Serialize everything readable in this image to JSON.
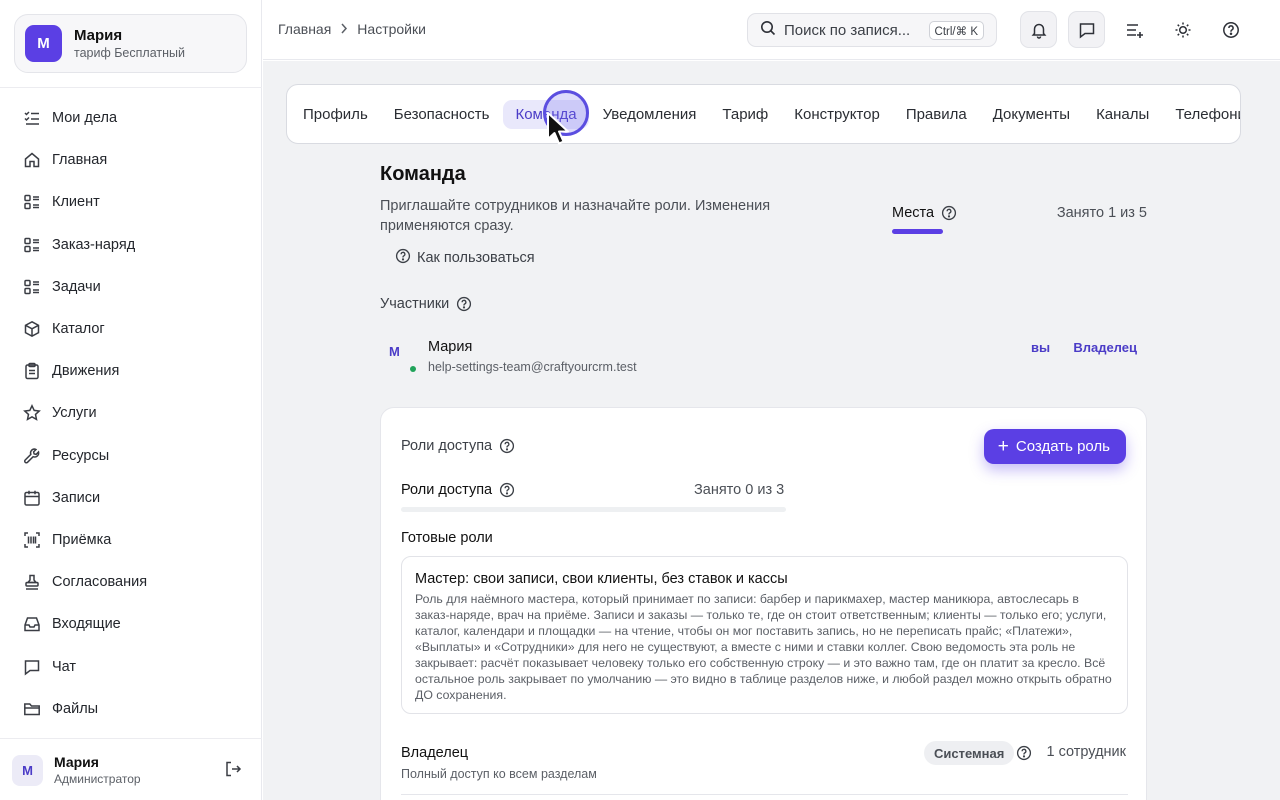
{
  "sidebar": {
    "account": {
      "initial": "М",
      "name": "Мария",
      "plan": "тариф Бесплатный"
    },
    "items": [
      {
        "label": "Мои дела",
        "icon": "checklist-icon"
      },
      {
        "label": "Главная",
        "icon": "home-icon"
      },
      {
        "label": "Клиент",
        "icon": "list-icon"
      },
      {
        "label": "Заказ-наряд",
        "icon": "list-icon"
      },
      {
        "label": "Задачи",
        "icon": "list-icon"
      },
      {
        "label": "Каталог",
        "icon": "box-icon"
      },
      {
        "label": "Движения",
        "icon": "clipboard-icon"
      },
      {
        "label": "Услуги",
        "icon": "star-icon"
      },
      {
        "label": "Ресурсы",
        "icon": "wrench-icon"
      },
      {
        "label": "Записи",
        "icon": "calendar-icon"
      },
      {
        "label": "Приёмка",
        "icon": "scan-icon"
      },
      {
        "label": "Согласования",
        "icon": "stamp-icon"
      },
      {
        "label": "Входящие",
        "icon": "inbox-icon"
      },
      {
        "label": "Чат",
        "icon": "chat-icon"
      },
      {
        "label": "Файлы",
        "icon": "folder-icon"
      }
    ],
    "user": {
      "initial": "М",
      "name": "Мария",
      "role": "Администратор"
    }
  },
  "topbar": {
    "breadcrumb": [
      "Главная",
      "Настройки"
    ],
    "search_placeholder": "Поиск по запися...",
    "shortcut": "Ctrl/⌘ K"
  },
  "tabs": [
    "Профиль",
    "Безопасность",
    "Команда",
    "Уведомления",
    "Тариф",
    "Конструктор",
    "Правила",
    "Документы",
    "Каналы",
    "Телефония"
  ],
  "active_tab": "Команда",
  "team": {
    "title": "Команда",
    "description": "Приглашайте сотрудников и назначайте роли. Изменения применяются сразу.",
    "help_link": "Как пользоваться",
    "seats_label": "Места",
    "seats_count": "Занято 1 из 5",
    "members_title": "Участники",
    "member": {
      "initial": "М",
      "name": "Мария",
      "email": "help-settings-team@craftyourcrm.test",
      "you_label": "вы",
      "role": "Владелец"
    }
  },
  "roles": {
    "title": "Роли доступа",
    "create_button": "Создать роль",
    "sub_title": "Роли доступа",
    "usage": "Занято 0 из 3",
    "usage_fraction": 0,
    "ready_title": "Готовые роли",
    "preset": {
      "title": "Мастер: свои записи, свои клиенты, без ставок и кассы",
      "description": "Роль для наёмного мастера, который принимает по записи: барбер и парикмахер, мастер маникюра, автослесарь в заказ-наряде, врач на приёме. Записи и заказы — только те, где он стоит ответственным; клиенты — только его; услуги, каталог, календари и площадки — на чтение, чтобы он мог поставить запись, но не переписать прайс; «Платежи», «Выплаты» и «Сотрудники» для него не существуют, а вместе с ними и ставки коллег. Свою ведомость эта роль не закрывает: расчёт показывает человеку только его собственную строку — и это важно там, где он платит за кресло. Всё остальное роль закрывает по умолчанию — это видно в таблице разделов ниже, и любой раздел можно открыть обратно ДО сохранения."
    },
    "owner": {
      "title": "Владелец",
      "description": "Полный доступ ко всем разделам",
      "badge": "Системная",
      "count": "1 сотрудник"
    }
  },
  "colors": {
    "accent": "#5b3fe4",
    "accent_text": "#4b3cc7",
    "online": "#20a35a"
  }
}
